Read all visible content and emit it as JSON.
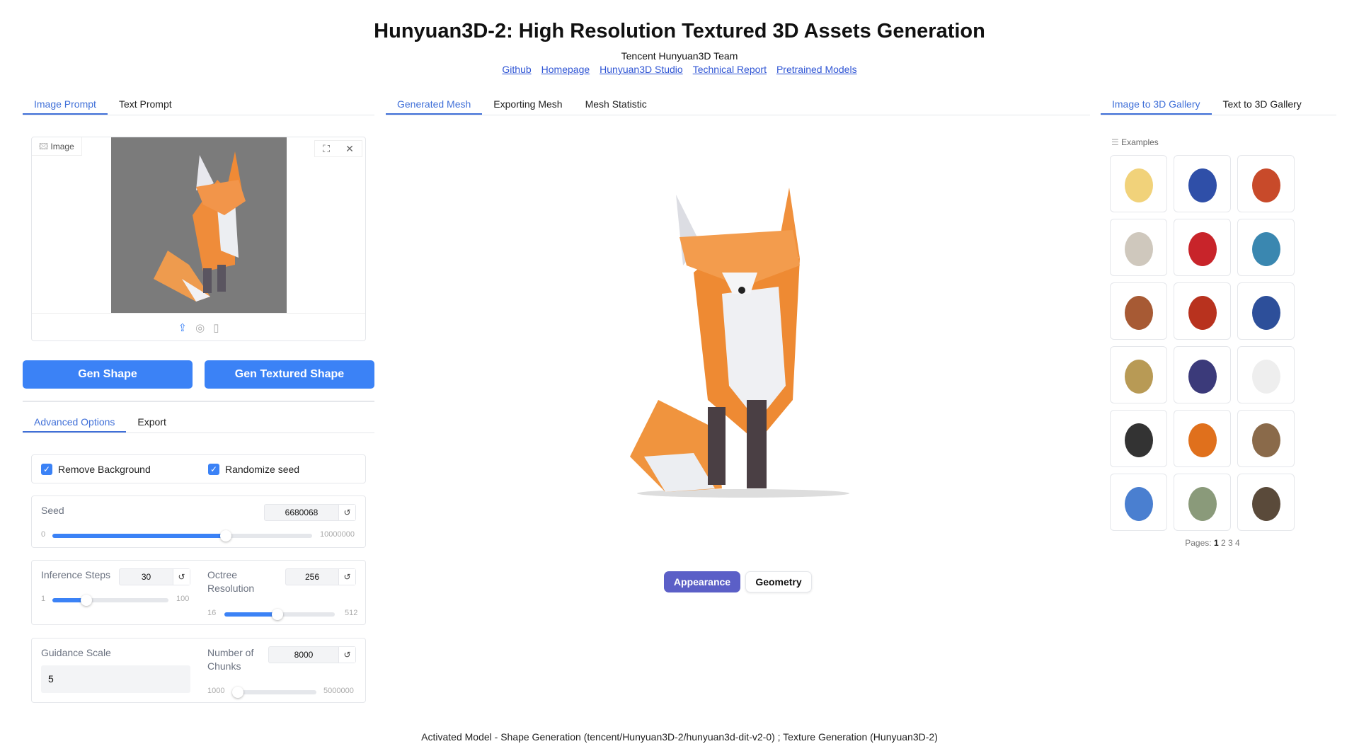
{
  "header": {
    "title": "Hunyuan3D-2: High Resolution Textured 3D Assets Generation",
    "subtitle": "Tencent Hunyuan3D Team",
    "links": [
      "Github",
      "Homepage",
      "Hunyuan3D Studio",
      "Technical Report",
      "Pretrained Models"
    ]
  },
  "left": {
    "tabs": [
      "Image Prompt",
      "Text Prompt"
    ],
    "image_label": "Image",
    "gen_shape": "Gen Shape",
    "gen_textured": "Gen Textured Shape",
    "option_tabs": [
      "Advanced Options",
      "Export"
    ],
    "remove_bg": "Remove Background",
    "randomize_seed": "Randomize seed",
    "seed": {
      "label": "Seed",
      "value": "6680068",
      "min": "0",
      "max": "10000000",
      "fraction": 0.668
    },
    "steps": {
      "label": "Inference Steps",
      "value": "30",
      "min": "1",
      "max": "100",
      "fraction": 0.29
    },
    "octree": {
      "label1": "Octree",
      "label2": "Resolution",
      "value": "256",
      "min": "16",
      "max": "512",
      "fraction": 0.48
    },
    "guidance": {
      "label": "Guidance Scale",
      "value": "5"
    },
    "chunks": {
      "label1": "Number of",
      "label2": "Chunks",
      "value": "8000",
      "min": "1000",
      "max": "5000000",
      "fraction": 0.0014
    },
    "reset_glyph": "↺"
  },
  "middle": {
    "tabs": [
      "Generated Mesh",
      "Exporting Mesh",
      "Mesh Statistic"
    ],
    "appearance": "Appearance",
    "geometry": "Geometry"
  },
  "right": {
    "tabs": [
      "Image to 3D Gallery",
      "Text to 3D Gallery"
    ],
    "examples": "Examples",
    "pages_label": "Pages:",
    "pages": [
      "1",
      "2",
      "3",
      "4"
    ]
  },
  "footer": "Activated Model - Shape Generation (tencent/Hunyuan3D-2/hunyuan3d-dit-v2-0) ; Texture Generation (Hunyuan3D-2)",
  "colors": {
    "accent": "#3b82f6",
    "appearance": "#5b5fc7"
  }
}
